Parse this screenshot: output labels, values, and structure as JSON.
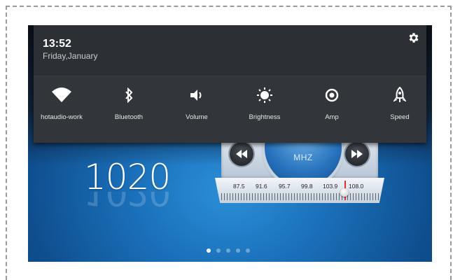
{
  "status": {
    "time": "13:52",
    "date": "Friday,January"
  },
  "quick_settings": {
    "tiles": [
      {
        "label": "hotaudio-work",
        "icon": "wifi-icon"
      },
      {
        "label": "Bluetooth",
        "icon": "bluetooth-icon"
      },
      {
        "label": "Volume",
        "icon": "volume-icon"
      },
      {
        "label": "Brightness",
        "icon": "brightness-icon"
      },
      {
        "label": "Amp",
        "icon": "amp-icon"
      },
      {
        "label": "Speed",
        "icon": "rocket-icon"
      }
    ],
    "settings_icon": "gear-icon"
  },
  "radio": {
    "unit": "MHZ",
    "scale": [
      "87.5",
      "91.6",
      "95.7",
      "99.8",
      "103.9",
      "108.0"
    ]
  },
  "clock_widget": {
    "digits": "1020"
  },
  "pager": {
    "pages": 5,
    "current": 1
  },
  "colors": {
    "panel": "#323539",
    "panel_top": "#2c2f33",
    "background_blue": "#1a6fb9"
  }
}
